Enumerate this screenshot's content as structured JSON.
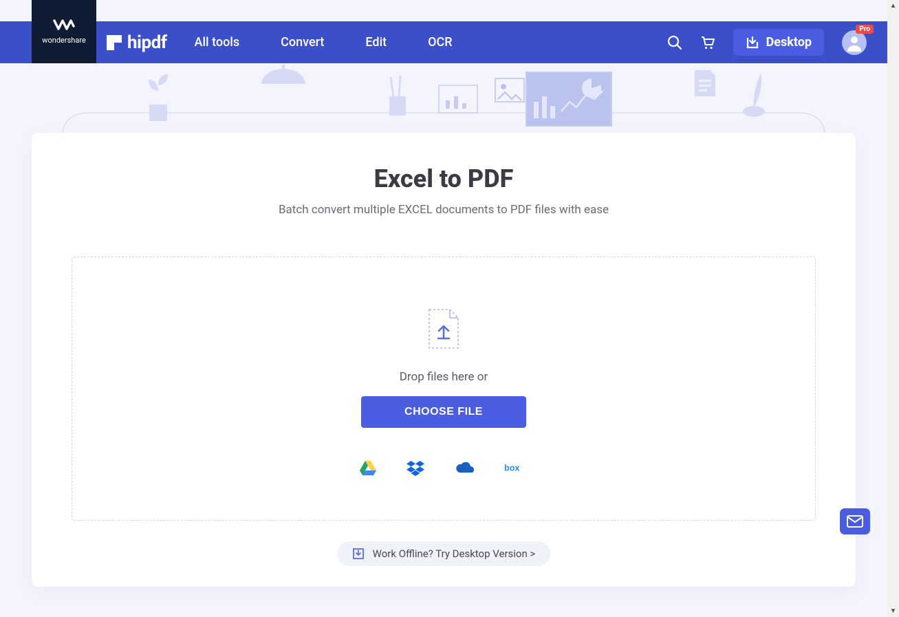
{
  "brand_parent": "wondershare",
  "brand": "hipdf",
  "nav": {
    "all_tools": "All tools",
    "convert": "Convert",
    "edit": "Edit",
    "ocr": "OCR",
    "desktop": "Desktop"
  },
  "avatar": {
    "pro_badge": "Pro"
  },
  "main": {
    "title": "Excel to PDF",
    "subtitle": "Batch convert multiple EXCEL documents to PDF files with ease",
    "drop_hint": "Drop files here or",
    "choose_button": "CHOOSE FILE",
    "offline_text": "Work Offline? Try Desktop Version >"
  },
  "cloud_names": {
    "gdrive": "google-drive",
    "dropbox": "dropbox",
    "onedrive": "onedrive",
    "box": "box"
  }
}
